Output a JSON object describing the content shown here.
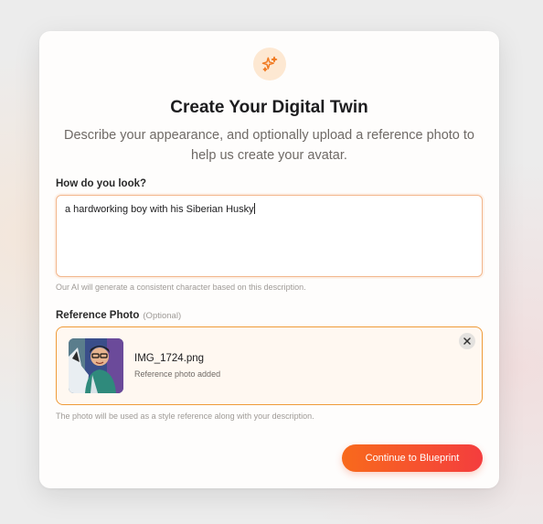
{
  "header": {
    "icon": "sparkles-icon",
    "title": "Create Your Digital Twin",
    "subtitle": "Describe your appearance, and optionally upload a reference photo to help us create your avatar."
  },
  "description": {
    "label": "How do you look?",
    "value": "a hardworking boy with his Siberian Husky",
    "hint": "Our AI will generate a consistent character based on this description."
  },
  "reference_photo": {
    "label": "Reference Photo",
    "optional_tag": "(Optional)",
    "filename": "IMG_1724.png",
    "status": "Reference photo added",
    "remove_icon": "close-icon",
    "hint": "The photo will be used as a style reference along with your description."
  },
  "actions": {
    "continue_label": "Continue to Blueprint"
  },
  "colors": {
    "accent_orange": "#f86a1c",
    "accent_red": "#f43d3e",
    "photo_border": "#ef9b39",
    "textarea_border": "#f2b58a"
  }
}
